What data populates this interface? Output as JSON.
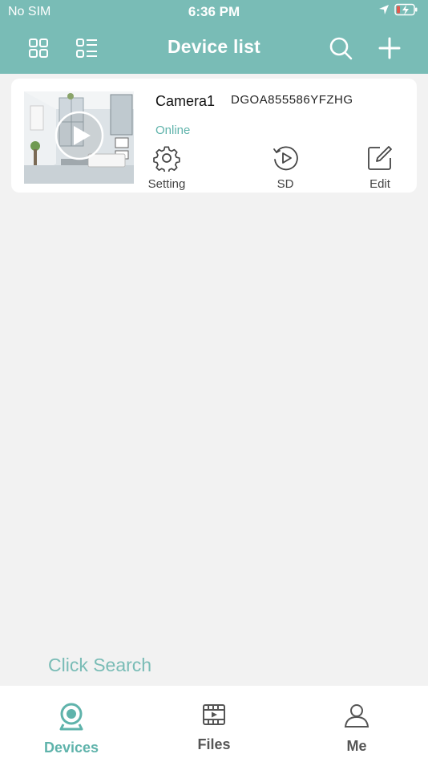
{
  "status_bar": {
    "carrier": "No SIM",
    "time": "6:36 PM"
  },
  "nav": {
    "title": "Device list",
    "left_icons": [
      "grid-view-icon",
      "list-view-icon"
    ],
    "right_icons": [
      "search-icon",
      "plus-icon"
    ]
  },
  "devices": [
    {
      "name": "Camera1",
      "id": "DGOA855586YFZHG",
      "status": "Online",
      "actions": [
        {
          "label": "Setting",
          "icon": "gear-icon"
        },
        {
          "label": "SD",
          "icon": "playback-icon"
        },
        {
          "label": "Edit",
          "icon": "edit-icon"
        }
      ]
    }
  ],
  "hint": "Click Search",
  "tabs": [
    {
      "label": "Devices",
      "icon": "camera-icon",
      "active": true
    },
    {
      "label": "Files",
      "icon": "film-icon",
      "active": false
    },
    {
      "label": "Me",
      "icon": "person-icon",
      "active": false
    }
  ],
  "colors": {
    "accent": "#79bcb6",
    "accent_text": "#5fb3ab",
    "background": "#f2f2f2"
  }
}
